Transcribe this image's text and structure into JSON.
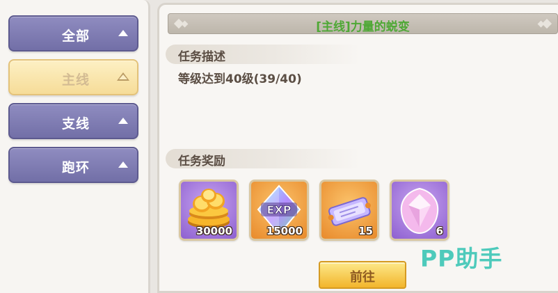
{
  "nav": {
    "items": [
      {
        "label": "全部",
        "active": false
      },
      {
        "label": "主线",
        "active": true
      },
      {
        "label": "支线",
        "active": false
      },
      {
        "label": "跑环",
        "active": false
      }
    ]
  },
  "quest": {
    "title": "[主线]力量的蜕变",
    "description_header": "任务描述",
    "description": "等级达到40级(39/40)",
    "rewards_header": "任务奖励",
    "rewards": [
      {
        "icon": "gold-coins-icon",
        "count": "30000"
      },
      {
        "icon": "exp-crystal-icon",
        "count": "15000"
      },
      {
        "icon": "ticket-icon",
        "count": "15"
      },
      {
        "icon": "pink-gem-icon",
        "count": "6"
      }
    ],
    "go_button": "前往"
  },
  "watermark": "PP助手",
  "colors": {
    "nav_default": "#7f7cb4",
    "nav_active": "#f8e2a6",
    "title_green": "#4ea835",
    "button_gold": "#f5c342"
  }
}
